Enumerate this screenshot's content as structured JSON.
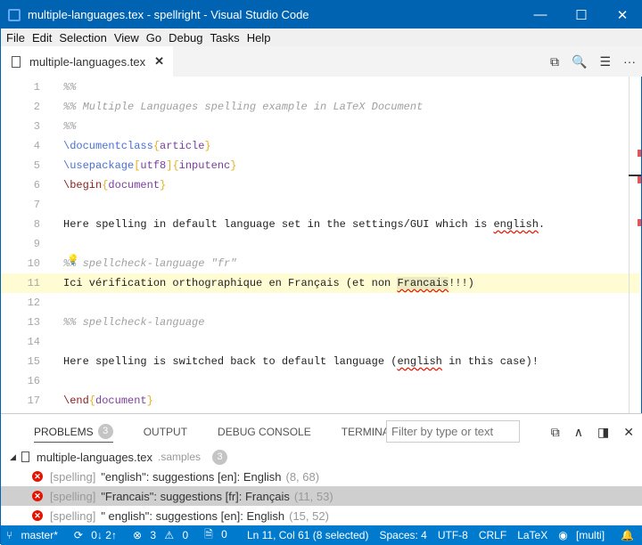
{
  "window": {
    "title": "multiple-languages.tex - spellright - Visual Studio Code",
    "minimize": "—",
    "maximize": "☐",
    "close": "✕"
  },
  "menu": [
    "File",
    "Edit",
    "Selection",
    "View",
    "Go",
    "Debug",
    "Tasks",
    "Help"
  ],
  "tab": {
    "label": "multiple-languages.tex",
    "close": "✕"
  },
  "editor_actions": [
    "⧉",
    "🔍",
    "☰",
    "···"
  ],
  "lines": [
    {
      "n": "1",
      "seg": [
        [
          "cmt",
          "%%"
        ]
      ]
    },
    {
      "n": "2",
      "seg": [
        [
          "cmt",
          "%% Multiple Languages spelling example in LaTeX Document"
        ]
      ]
    },
    {
      "n": "3",
      "seg": [
        [
          "cmt",
          "%%"
        ]
      ]
    },
    {
      "n": "4",
      "seg": [
        [
          "cmd",
          "\\documentclass"
        ],
        [
          "br",
          "{"
        ],
        [
          "arg",
          "article"
        ],
        [
          "br",
          "}"
        ]
      ]
    },
    {
      "n": "5",
      "seg": [
        [
          "cmd",
          "\\usepackage"
        ],
        [
          "br",
          "["
        ],
        [
          "arg",
          "utf8"
        ],
        [
          "br",
          "]"
        ],
        [
          "br",
          "{"
        ],
        [
          "arg",
          "inputenc"
        ],
        [
          "br",
          "}"
        ]
      ]
    },
    {
      "n": "6",
      "seg": [
        [
          "kw",
          "\\begin"
        ],
        [
          "br",
          "{"
        ],
        [
          "arg",
          "document"
        ],
        [
          "br",
          "}"
        ]
      ]
    },
    {
      "n": "7",
      "seg": []
    },
    {
      "n": "8",
      "seg": [
        [
          "txt",
          "Here spelling in default language set in the settings/GUI which is "
        ],
        [
          "txt err",
          "english"
        ],
        [
          "txt",
          "."
        ]
      ]
    },
    {
      "n": "9",
      "seg": []
    },
    {
      "n": "10",
      "seg": [
        [
          "cmt",
          "%% spellcheck-language \"fr\""
        ]
      ]
    },
    {
      "n": "11",
      "seg": [
        [
          "txt",
          "Ici vérification orthographique en Français (et non "
        ],
        [
          "txt err sel",
          "Francais"
        ],
        [
          "txt",
          "!!!)"
        ]
      ]
    },
    {
      "n": "12",
      "seg": []
    },
    {
      "n": "13",
      "seg": [
        [
          "cmt",
          "%% spellcheck-language"
        ]
      ]
    },
    {
      "n": "14",
      "seg": []
    },
    {
      "n": "15",
      "seg": [
        [
          "txt",
          "Here spelling is switched back to default language ("
        ],
        [
          "txt err",
          "english"
        ],
        [
          "txt",
          " in this case)!"
        ]
      ]
    },
    {
      "n": "16",
      "seg": []
    },
    {
      "n": "17",
      "seg": [
        [
          "kw",
          "\\end"
        ],
        [
          "br",
          "{"
        ],
        [
          "arg",
          "document"
        ],
        [
          "br",
          "}"
        ]
      ]
    }
  ],
  "current_line": "11",
  "panel": {
    "tabs": [
      "PROBLEMS",
      "OUTPUT",
      "DEBUG CONSOLE",
      "TERMINAL"
    ],
    "problems_count": "3",
    "filter_placeholder": "Filter by type or text",
    "file": {
      "name": "multiple-languages.tex",
      "folder": ".samples",
      "count": "3"
    },
    "problems": [
      {
        "source": "[spelling]",
        "message": "\"english\": suggestions [en]: English",
        "pos": "(8, 68)"
      },
      {
        "source": "[spelling]",
        "message": "\"Francais\": suggestions [fr]: Français",
        "pos": "(11, 53)",
        "selected": true
      },
      {
        "source": "[spelling]",
        "message": "\" english\": suggestions [en]: English",
        "pos": "(15, 52)"
      }
    ]
  },
  "status": {
    "branch": "master*",
    "sync": "0↓ 2↑",
    "errors": "3",
    "warnings": "0",
    "info": "0",
    "position": "Ln 11, Col 61 (8 selected)",
    "spaces": "Spaces: 4",
    "encoding": "UTF-8",
    "eol": "CRLF",
    "language": "LaTeX",
    "spell": "[multi]"
  },
  "colors": {
    "titlebar": "#0063b1",
    "statusbar": "#007acc",
    "error": "#e51400"
  }
}
